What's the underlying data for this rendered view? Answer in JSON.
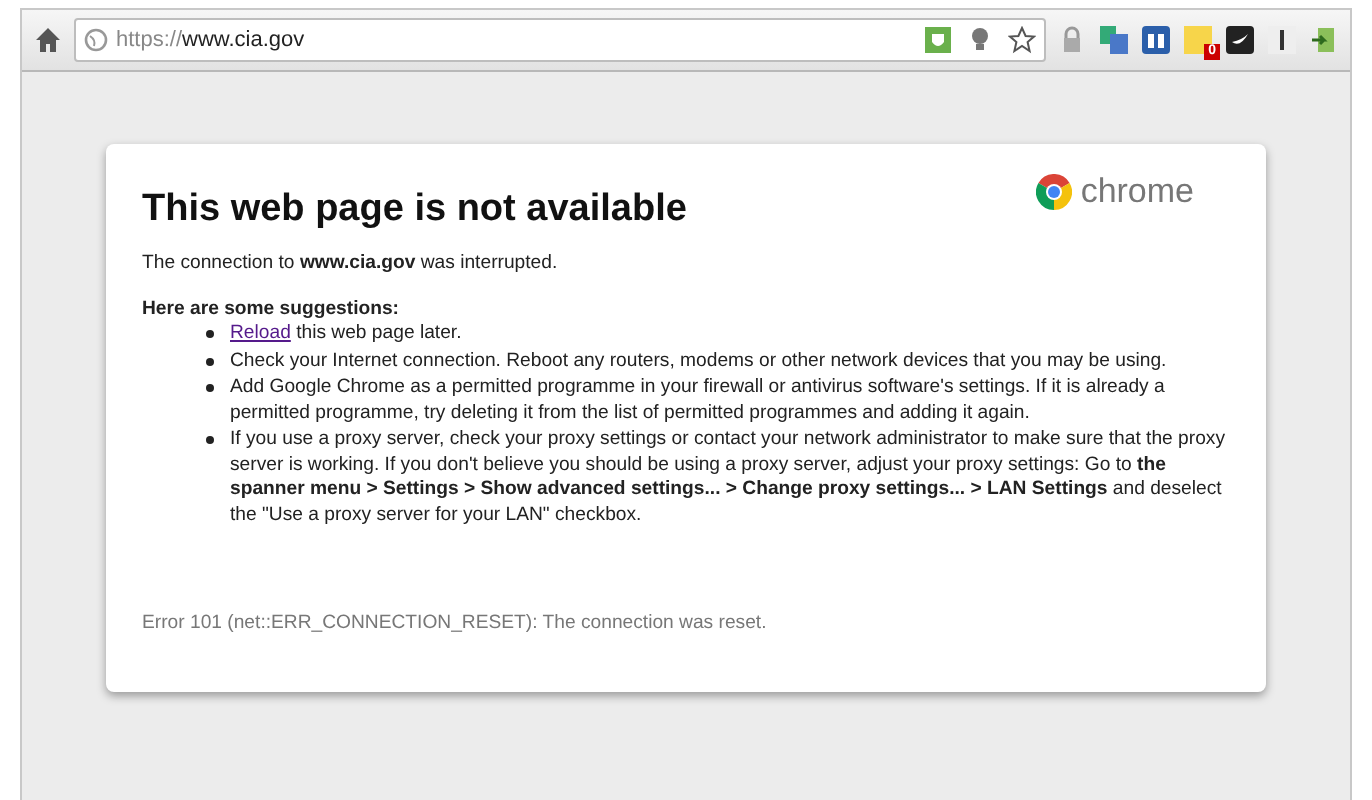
{
  "toolbar": {
    "url_scheme": "https://",
    "url_host": "www.cia.gov",
    "badge": "0"
  },
  "error_page": {
    "title": "This web page is not available",
    "brand": "chrome",
    "intro": "The connection to **www.cia.gov** was interrupted.",
    "suggestions_heading": "Here are some suggestions:",
    "suggestions": [
      {
        "link": "Reload",
        "text": " this web page later."
      },
      {
        "text": "Check your Internet connection. Reboot any routers, modems or other network devices that you may be using."
      },
      {
        "text": "Add Google Chrome as a permitted programme in your firewall or antivirus software's settings. If it is already a permitted programme, try deleting it from the list of permitted programmes and adding it again."
      },
      {
        "text": "If you use a proxy server, check your proxy settings or contact your network administrator to make sure that the proxy server is working. If you don't believe you should be using a proxy server, adjust your proxy settings: Go to **the spanner menu > Settings > Show advanced settings... > Change proxy settings... > LAN Settings** and deselect the \"Use a proxy server for your LAN\" checkbox."
      }
    ],
    "error_code": "Error 101 (net::ERR_CONNECTION_RESET): The connection was reset."
  }
}
